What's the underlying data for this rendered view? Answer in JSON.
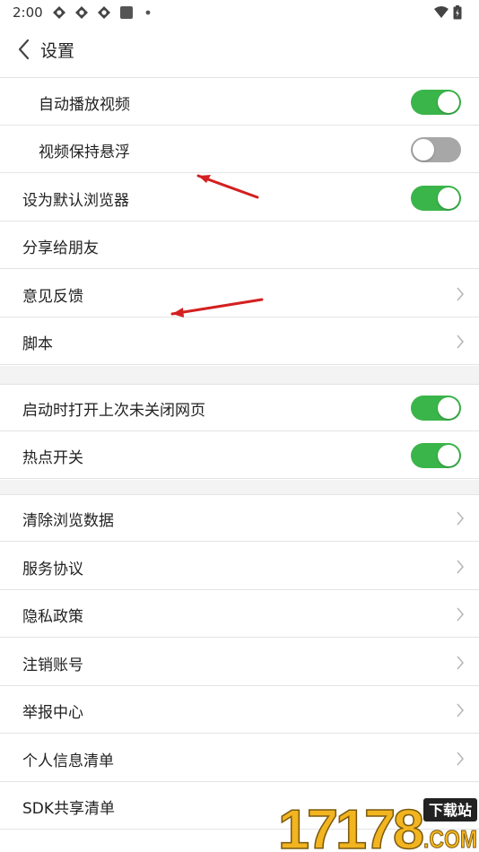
{
  "status_bar": {
    "time": "2:00",
    "icons": [
      "app-notification-icon",
      "app-notification-icon",
      "app-notification-icon",
      "square-notification-icon",
      "dot-icon",
      "wifi-icon",
      "battery-icon"
    ]
  },
  "header": {
    "title": "设置"
  },
  "rows": [
    {
      "label": "自动播放视频",
      "control": "toggle",
      "on": true
    },
    {
      "label": "视频保持悬浮",
      "control": "toggle",
      "on": false
    },
    {
      "label": "设为默认浏览器",
      "control": "toggle",
      "on": true
    },
    {
      "label": "分享给朋友",
      "control": "none"
    },
    {
      "label": "意见反馈",
      "control": "chevron"
    },
    {
      "label": "脚本",
      "control": "chevron"
    },
    {
      "label": "启动时打开上次未关闭网页",
      "control": "toggle",
      "on": true
    },
    {
      "label": "热点开关",
      "control": "toggle",
      "on": true
    },
    {
      "label": "清除浏览数据",
      "control": "chevron"
    },
    {
      "label": "服务协议",
      "control": "chevron"
    },
    {
      "label": "隐私政策",
      "control": "chevron"
    },
    {
      "label": "注销账号",
      "control": "chevron"
    },
    {
      "label": "举报中心",
      "control": "chevron"
    },
    {
      "label": "个人信息清单",
      "control": "chevron"
    },
    {
      "label": "SDK共享清单",
      "control": "none"
    }
  ],
  "watermark": {
    "number": "17178",
    "tag": "下载站",
    "domain": ".COM"
  },
  "colors": {
    "toggle_on": "#3ab54a",
    "toggle_off": "#a7a7a7",
    "annotation_arrow": "#d42020",
    "section_gap": "#f3f3f3"
  }
}
